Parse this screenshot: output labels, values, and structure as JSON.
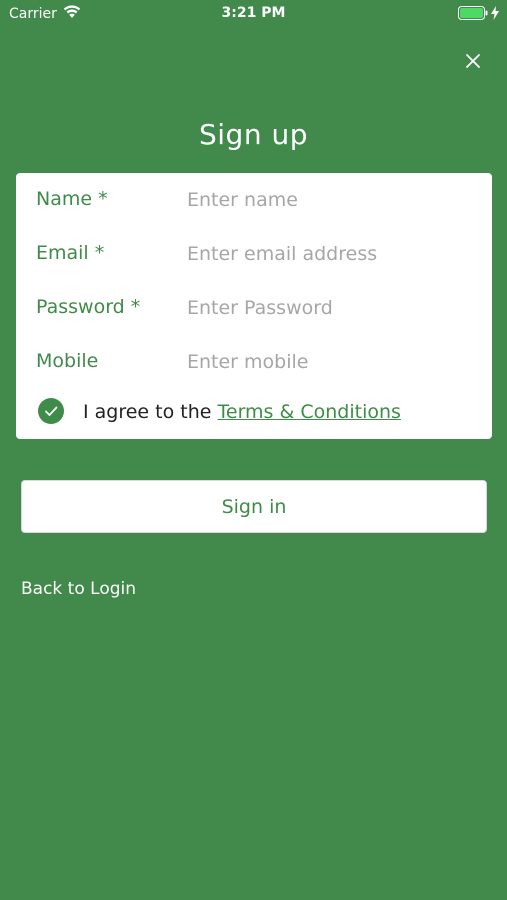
{
  "status_bar": {
    "carrier": "Carrier",
    "time": "3:21 PM",
    "icons": [
      "wifi-icon",
      "battery-icon",
      "charging-icon"
    ]
  },
  "header": {
    "title": "Sign up",
    "close_icon": "close-icon"
  },
  "form": {
    "fields": [
      {
        "label": "Name *",
        "placeholder": "Enter name",
        "value": ""
      },
      {
        "label": "Email *",
        "placeholder": "Enter email address",
        "value": ""
      },
      {
        "label": "Password *",
        "placeholder": "Enter Password",
        "value": ""
      },
      {
        "label": "Mobile",
        "placeholder": "Enter mobile",
        "value": ""
      }
    ],
    "agree": {
      "checked": true,
      "text": "I agree to the ",
      "link_text": "Terms & Conditions"
    }
  },
  "actions": {
    "primary_label": "Sign in",
    "back_label": "Back to Login"
  },
  "colors": {
    "background": "#418a4b",
    "accent": "#3f8b49",
    "card": "#ffffff",
    "placeholder": "#a6a6a6",
    "battery": "#4cd964"
  }
}
